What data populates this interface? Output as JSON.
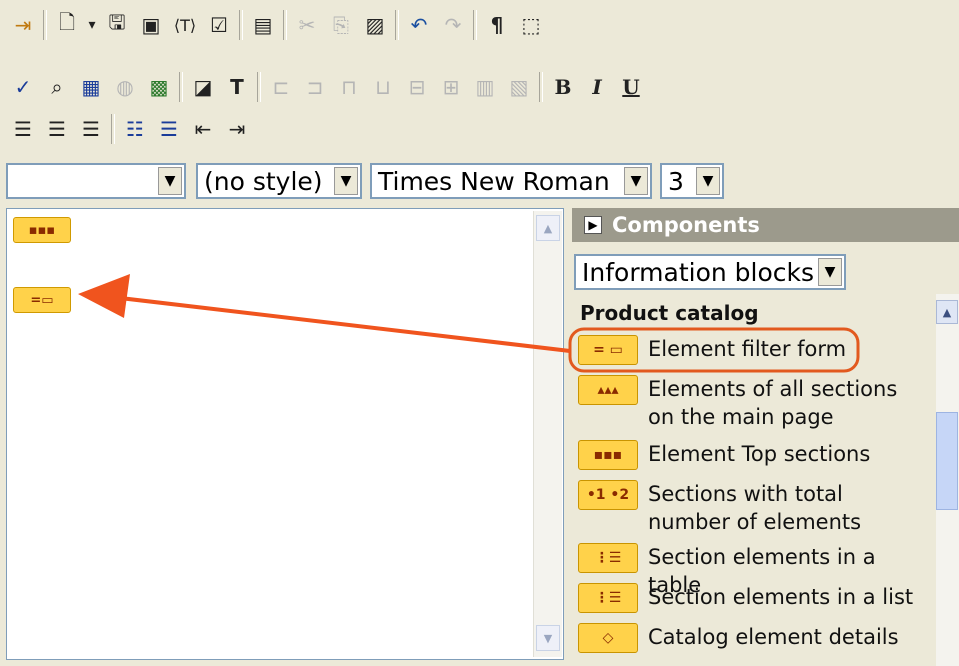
{
  "toolbar": {
    "row1": [
      {
        "name": "exit-icon",
        "glyph": "⇥"
      },
      {
        "name": "new-doc-icon",
        "glyph": "🗋"
      },
      {
        "name": "dropdown-arrow-icon",
        "glyph": "▾"
      },
      {
        "name": "save-icon",
        "glyph": "💾"
      },
      {
        "name": "save-as-icon",
        "glyph": "▣"
      },
      {
        "name": "template-tag-icon",
        "glyph": "⟨T⟩"
      },
      {
        "name": "properties-icon",
        "glyph": "☑"
      },
      {
        "name": "page-icon",
        "glyph": "▤"
      },
      {
        "name": "cut-icon",
        "glyph": "✂"
      },
      {
        "name": "copy-icon",
        "glyph": "⎘"
      },
      {
        "name": "paste-icon",
        "glyph": "📋"
      },
      {
        "name": "undo-icon",
        "glyph": "↶"
      },
      {
        "name": "redo-icon",
        "glyph": "↷"
      },
      {
        "name": "paragraph-icon",
        "glyph": "¶"
      },
      {
        "name": "show-borders-icon",
        "glyph": "⬚"
      }
    ],
    "row2": [
      {
        "name": "spellcheck-icon",
        "glyph": "✓"
      },
      {
        "name": "find-icon",
        "glyph": "👓"
      },
      {
        "name": "table-icon",
        "glyph": "▦"
      },
      {
        "name": "globe-icon",
        "glyph": "◍"
      },
      {
        "name": "image-icon",
        "glyph": "▩"
      },
      {
        "name": "background-color-icon",
        "glyph": "◪"
      },
      {
        "name": "text-color-icon",
        "glyph": "T"
      },
      {
        "name": "insert-col-left-icon",
        "glyph": "⊏"
      },
      {
        "name": "insert-col-right-icon",
        "glyph": "⊐"
      },
      {
        "name": "insert-row-above-icon",
        "glyph": "⊓"
      },
      {
        "name": "insert-row-below-icon",
        "glyph": "⊔"
      },
      {
        "name": "delete-col-icon",
        "glyph": "⊟"
      },
      {
        "name": "delete-row-icon",
        "glyph": "⊞"
      },
      {
        "name": "merge-cells-icon",
        "glyph": "▥"
      },
      {
        "name": "split-cells-icon",
        "glyph": "▧"
      }
    ],
    "bold": "B",
    "italic": "I",
    "underline": "U",
    "row3": [
      {
        "name": "align-left-icon",
        "glyph": "≡"
      },
      {
        "name": "align-center-icon",
        "glyph": "≡"
      },
      {
        "name": "align-right-icon",
        "glyph": "≡"
      },
      {
        "name": "numbered-list-icon",
        "glyph": "⋮≡"
      },
      {
        "name": "bullet-list-icon",
        "glyph": "•≡"
      },
      {
        "name": "outdent-icon",
        "glyph": "⇤"
      },
      {
        "name": "indent-icon",
        "glyph": "⇥"
      }
    ]
  },
  "format": {
    "block": "",
    "style": "(no style)",
    "font": "Times New Roman",
    "size": "3"
  },
  "editor": {
    "chip1": "▪▪▪",
    "chip2": "=▭"
  },
  "components": {
    "title": "Components",
    "category": "Information blocks",
    "group": "Product catalog",
    "items": [
      {
        "label": "Element filter form",
        "icon": "= ▭"
      },
      {
        "label": "Elements of all sections on the main page",
        "icon": "▴▴▴"
      },
      {
        "label": "Element Top sections",
        "icon": "▪▪▪"
      },
      {
        "label": "Sections with total number of elements",
        "icon": "•1 •2"
      },
      {
        "label": "Section elements in a table",
        "icon": "⋮☰"
      },
      {
        "label": "Section elements in a list",
        "icon": "⋮☰"
      },
      {
        "label": "Catalog element details",
        "icon": "◇"
      }
    ]
  },
  "colors": {
    "highlight": "#e2591e",
    "panel_header": "#9c9a8c",
    "chip": "#ffd24a"
  }
}
